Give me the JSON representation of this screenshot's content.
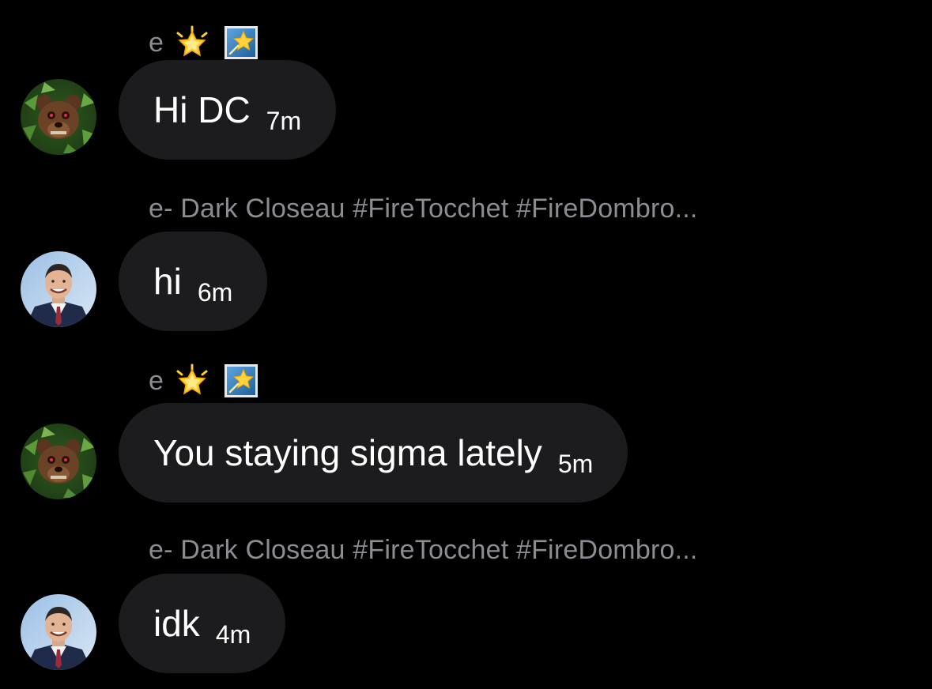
{
  "messages": [
    {
      "sender": "e",
      "sender_has_emojis": true,
      "avatar_icon": "bear-avatar-icon",
      "text": "Hi DC",
      "time": "7m"
    },
    {
      "sender": "e- Dark Closeau #FireTocchet #FireDombro...",
      "sender_has_emojis": false,
      "avatar_icon": "man-in-suit-avatar-icon",
      "text": "hi",
      "time": "6m"
    },
    {
      "sender": "e",
      "sender_has_emojis": true,
      "avatar_icon": "bear-avatar-icon",
      "text": "You staying sigma lately",
      "time": "5m"
    },
    {
      "sender": "e- Dark Closeau #FireTocchet #FireDombro...",
      "sender_has_emojis": false,
      "avatar_icon": "man-in-suit-avatar-icon",
      "text": "idk",
      "time": "4m"
    }
  ],
  "colors": {
    "background": "#000000",
    "bubble": "#1c1c1e",
    "sender_text": "#8b8d92",
    "message_text": "#ffffff"
  }
}
